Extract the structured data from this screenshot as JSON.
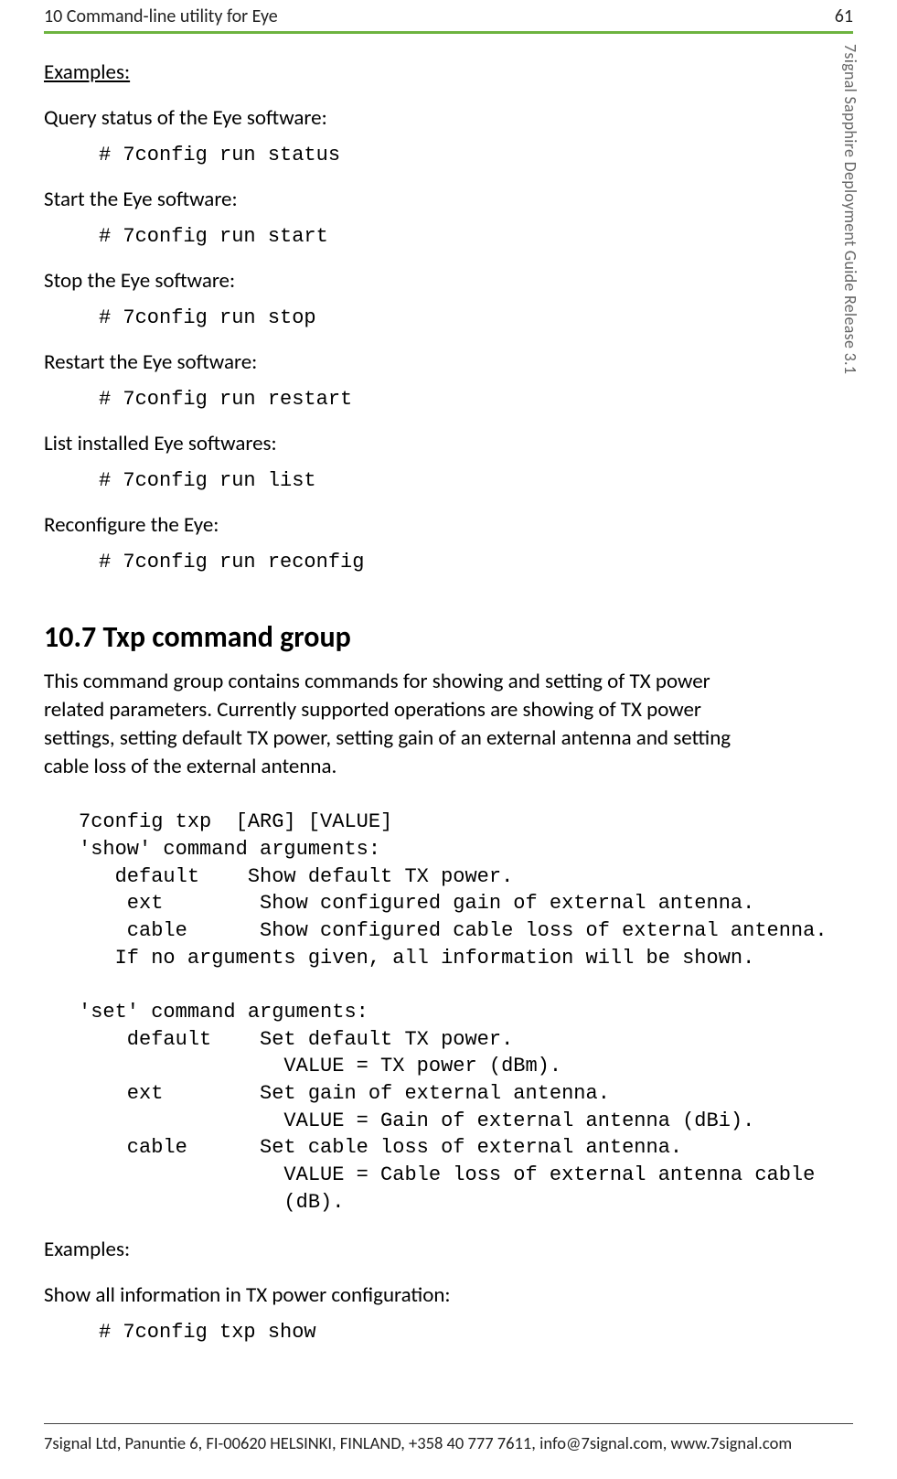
{
  "header": {
    "left": "10 Command-line utility for Eye",
    "right": "61"
  },
  "sideText": "7signal Sapphire Deployment Guide Release 3.1",
  "examplesHeading": "Examples:",
  "examples": [
    {
      "desc": "Query status of the Eye software:",
      "cmd": "# 7config run status"
    },
    {
      "desc": "Start the Eye software:",
      "cmd": "# 7config run start"
    },
    {
      "desc": "Stop the Eye software:",
      "cmd": "# 7config run stop"
    },
    {
      "desc": "Restart the Eye software:",
      "cmd": "# 7config run restart"
    },
    {
      "desc": "List installed Eye softwares:",
      "cmd": "# 7config run list"
    },
    {
      "desc": "Reconfigure the Eye:",
      "cmd": "# 7config run reconfig"
    }
  ],
  "section": {
    "heading": "10.7 Txp command group",
    "body": "This command group contains commands for showing and setting of TX power related parameters. Currently supported operations are showing of TX power settings, setting default TX power, setting gain of an external antenna and setting cable loss of the external antenna.",
    "usageBlock": "7config txp  [ARG] [VALUE]\n'show' command arguments:\n   default    Show default TX power.\n    ext        Show configured gain of external antenna.\n    cable      Show configured cable loss of external antenna.\n   If no arguments given, all information will be shown.\n\n'set' command arguments:\n    default    Set default TX power.\n                 VALUE = TX power (dBm).\n    ext        Set gain of external antenna.\n                 VALUE = Gain of external antenna (dBi).\n    cable      Set cable loss of external antenna.\n                 VALUE = Cable loss of external antenna cable\n                 (dB)."
  },
  "examples2Heading": "Examples:",
  "examples2": [
    {
      "desc": "Show all information in TX power configuration:",
      "cmd": "# 7config txp show"
    }
  ],
  "footer": "7signal Ltd, Panuntie 6, FI-00620 HELSINKI, FINLAND, +358 40 777 7611, info@7signal.com, www.7signal.com"
}
